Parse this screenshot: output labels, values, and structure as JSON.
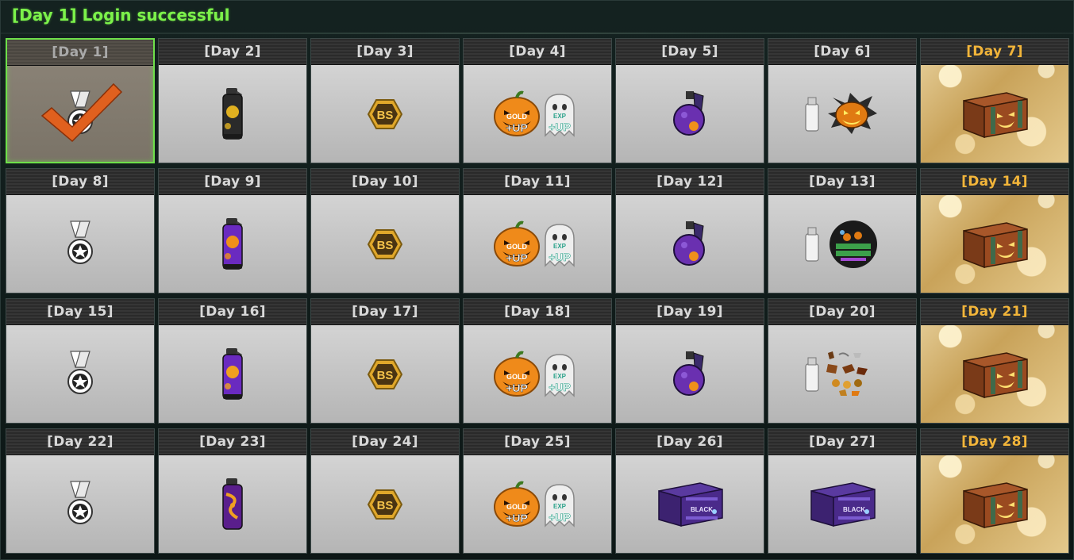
{
  "title": "[Day 1] Login successful",
  "colors": {
    "title": "#7cf24a",
    "gold_label": "#f2b53a",
    "claimed_border": "#6ee04a"
  },
  "days": [
    {
      "label": "[Day 1]",
      "reward": "medal-icon",
      "status": "claimed"
    },
    {
      "label": "[Day 2]",
      "reward": "grenade-canister-black-icon",
      "status": "normal"
    },
    {
      "label": "[Day 3]",
      "reward": "bs-coin-icon",
      "status": "normal"
    },
    {
      "label": "[Day 4]",
      "reward": "gold-exp-up-icon",
      "status": "normal",
      "badges": [
        "GOLD",
        "+UP",
        "EXP",
        "+UP"
      ]
    },
    {
      "label": "[Day 5]",
      "reward": "purple-grenade-icon",
      "status": "normal"
    },
    {
      "label": "[Day 6]",
      "reward": "pumpkin-spray-icon",
      "status": "normal"
    },
    {
      "label": "[Day 7]",
      "reward": "pumpkin-crate-icon",
      "status": "gold"
    },
    {
      "label": "[Day 8]",
      "reward": "medal-icon",
      "status": "normal"
    },
    {
      "label": "[Day 9]",
      "reward": "grenade-canister-purple-icon",
      "status": "normal"
    },
    {
      "label": "[Day 10]",
      "reward": "bs-coin-icon",
      "status": "normal"
    },
    {
      "label": "[Day 11]",
      "reward": "gold-exp-up-icon",
      "status": "normal",
      "badges": [
        "GOLD",
        "+UP",
        "EXP",
        "+UP"
      ]
    },
    {
      "label": "[Day 12]",
      "reward": "purple-grenade-icon",
      "status": "normal"
    },
    {
      "label": "[Day 13]",
      "reward": "halloween-spray-icon",
      "status": "normal"
    },
    {
      "label": "[Day 14]",
      "reward": "pumpkin-crate-icon",
      "status": "gold"
    },
    {
      "label": "[Day 15]",
      "reward": "medal-icon",
      "status": "normal"
    },
    {
      "label": "[Day 16]",
      "reward": "grenade-canister-orange-icon",
      "status": "normal"
    },
    {
      "label": "[Day 17]",
      "reward": "bs-coin-icon",
      "status": "normal"
    },
    {
      "label": "[Day 18]",
      "reward": "gold-exp-up-icon",
      "status": "normal",
      "badges": [
        "GOLD",
        "+UP",
        "EXP",
        "+UP"
      ]
    },
    {
      "label": "[Day 19]",
      "reward": "purple-grenade-icon",
      "status": "normal"
    },
    {
      "label": "[Day 20]",
      "reward": "sticker-spray-icon",
      "status": "normal"
    },
    {
      "label": "[Day 21]",
      "reward": "pumpkin-crate-icon",
      "status": "gold"
    },
    {
      "label": "[Day 22]",
      "reward": "medal-icon",
      "status": "normal"
    },
    {
      "label": "[Day 23]",
      "reward": "grenade-canister-swirl-icon",
      "status": "normal"
    },
    {
      "label": "[Day 24]",
      "reward": "bs-coin-icon",
      "status": "normal"
    },
    {
      "label": "[Day 25]",
      "reward": "gold-exp-up-icon",
      "status": "normal",
      "badges": [
        "GOLD",
        "+UP",
        "EXP",
        "+UP"
      ]
    },
    {
      "label": "[Day 26]",
      "reward": "blacksquad-crate-icon",
      "status": "normal"
    },
    {
      "label": "[Day 27]",
      "reward": "blacksquad-crate-icon",
      "status": "normal"
    },
    {
      "label": "[Day 28]",
      "reward": "pumpkin-crate-icon",
      "status": "gold"
    }
  ]
}
